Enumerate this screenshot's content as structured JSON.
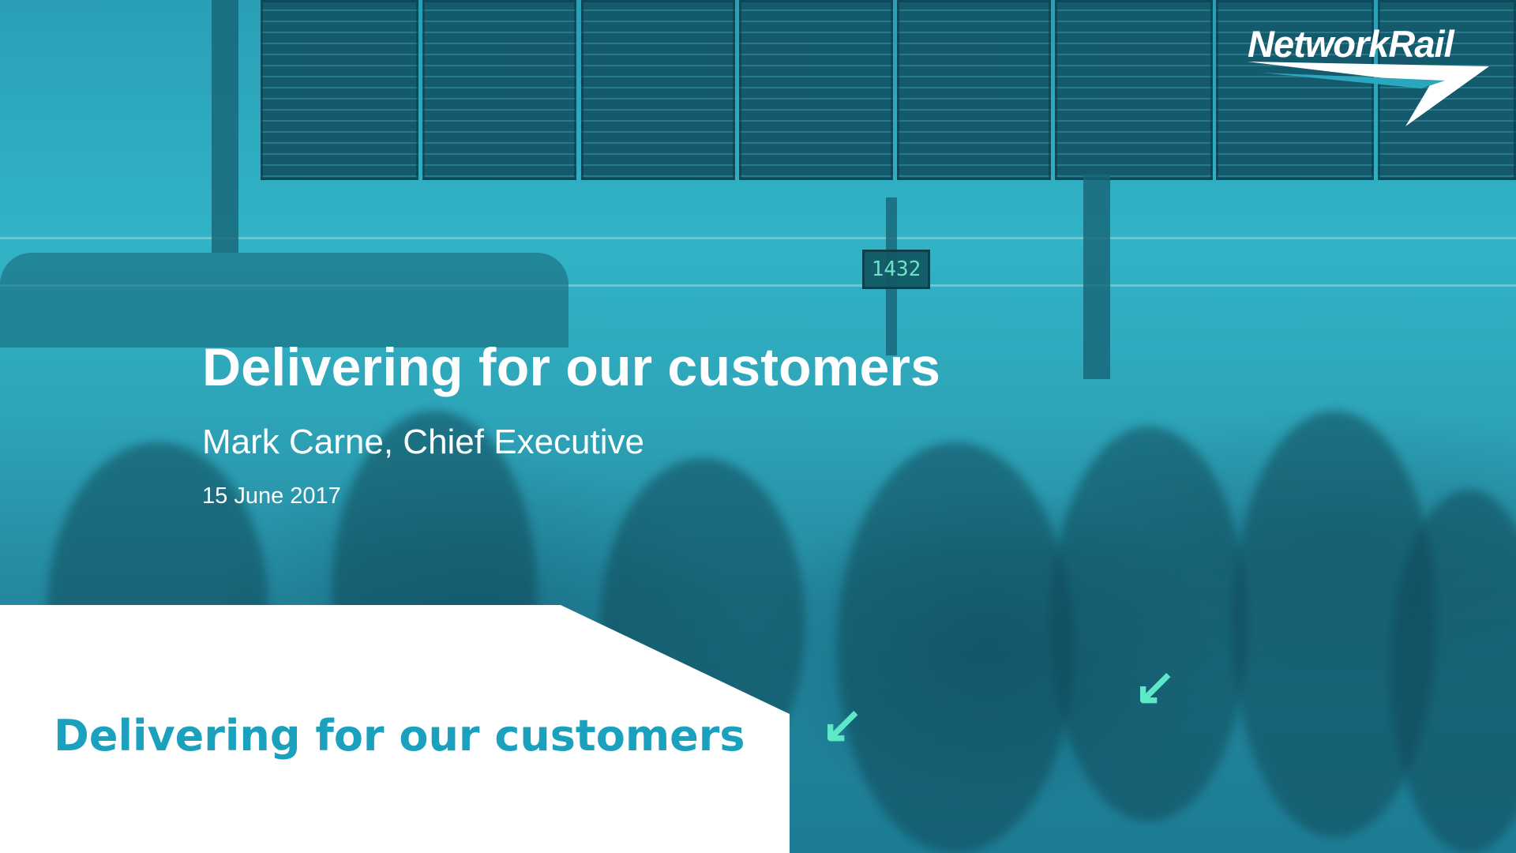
{
  "slide": {
    "title": "Delivering for our customers",
    "presenter": "Mark Carne, Chief Executive",
    "date": "15 June 2017",
    "tagline": "Delivering for our customers"
  },
  "logo": {
    "text": "NetworkRail"
  },
  "background": {
    "clock_display": "1432",
    "overlay_color": "#2aa7bd",
    "tagline_color": "#1ba0bd"
  }
}
